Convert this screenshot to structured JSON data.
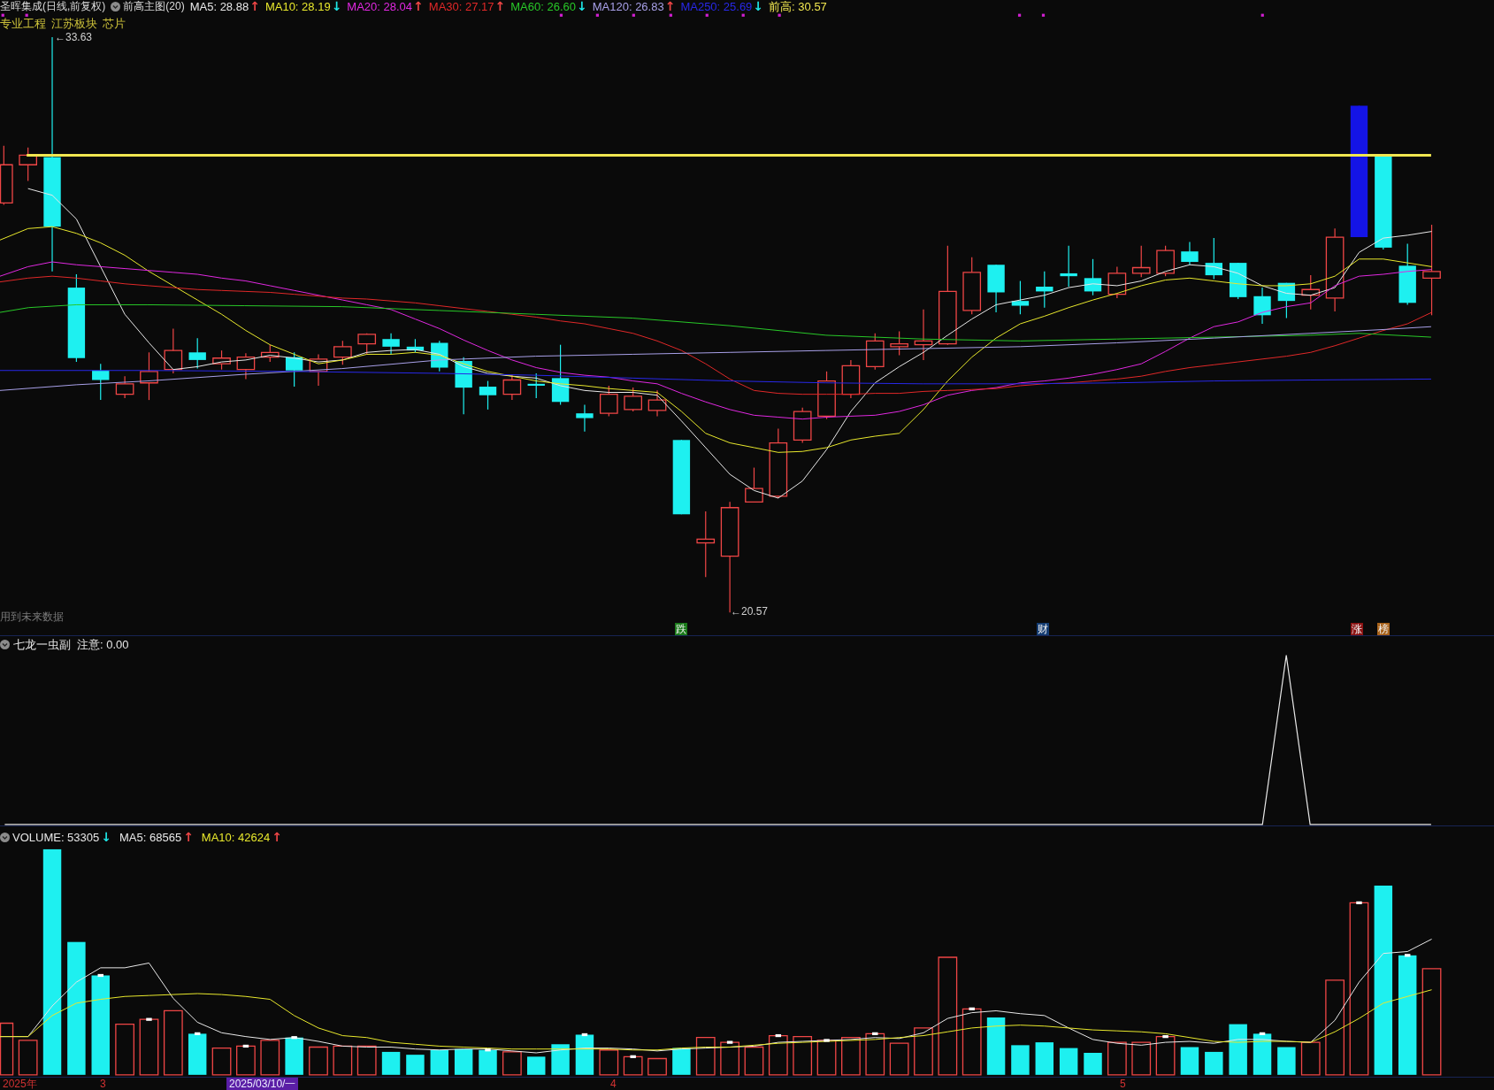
{
  "main_chart": {
    "title": "圣晖集成(日线,前复权)",
    "indicator": "前高主图(20)",
    "moving_averages": [
      {
        "label": "MA5: 28.88",
        "arrow": {
          "text": "↑",
          "color": "#f04646"
        },
        "color": "#e8e8e8"
      },
      {
        "label": "MA10: 28.19",
        "arrow": {
          "text": "↓",
          "color": "#1ee6e6"
        },
        "color": "#e8e82c"
      },
      {
        "label": "MA20: 28.04",
        "arrow": {
          "text": "↑",
          "color": "#f04646"
        },
        "color": "#e028e0"
      },
      {
        "label": "MA30: 27.17",
        "arrow": {
          "text": "↑",
          "color": "#f04646"
        },
        "color": "#e02828"
      },
      {
        "label": "MA60: 26.60",
        "arrow": {
          "text": "↓",
          "color": "#1ee6e6"
        },
        "color": "#28c828"
      },
      {
        "label": "MA120: 26.83",
        "arrow": {
          "text": "↑",
          "color": "#f04646"
        },
        "color": "#a8a0e8"
      },
      {
        "label": "MA250: 25.69",
        "arrow": {
          "text": "↓",
          "color": "#1ee6e6"
        },
        "color": "#2828e8"
      }
    ],
    "previous_high": {
      "label": "前高: 30.57",
      "color": "#f0e650"
    },
    "sector_tags": [
      "专业工程",
      "江苏板块",
      "芯片"
    ],
    "high_label": "←33.63",
    "low_label": "←20.57",
    "notice": "用到未来数据",
    "event_tags": [
      {
        "text": "跌",
        "color": "#1a7a1a"
      },
      {
        "text": "财",
        "color": "#143c72"
      },
      {
        "text": "涨",
        "color": "#8c1414"
      },
      {
        "text": "榜",
        "color": "#a8621a"
      }
    ]
  },
  "sub_chart": {
    "title": "七龙一虫副",
    "reading": "注意: 0.00"
  },
  "volume_chart": {
    "volume": {
      "label": "VOLUME: 53305",
      "arrow": {
        "text": "↓",
        "color": "#1ee6e6"
      }
    },
    "averages": [
      {
        "label": "MA5: 68565",
        "arrow": {
          "text": "↑",
          "color": "#f04646"
        },
        "color": "#e8e8e8"
      },
      {
        "label": "MA10: 42624",
        "arrow": {
          "text": "↑",
          "color": "#f04646"
        },
        "color": "#e8e82c"
      }
    ]
  },
  "time_axis": [
    {
      "label": "2025年",
      "selected": false
    },
    {
      "label": "3",
      "selected": false
    },
    {
      "label": "2025/03/10/一",
      "selected": true
    },
    {
      "label": "4",
      "selected": false
    },
    {
      "label": "5",
      "selected": false
    }
  ]
}
